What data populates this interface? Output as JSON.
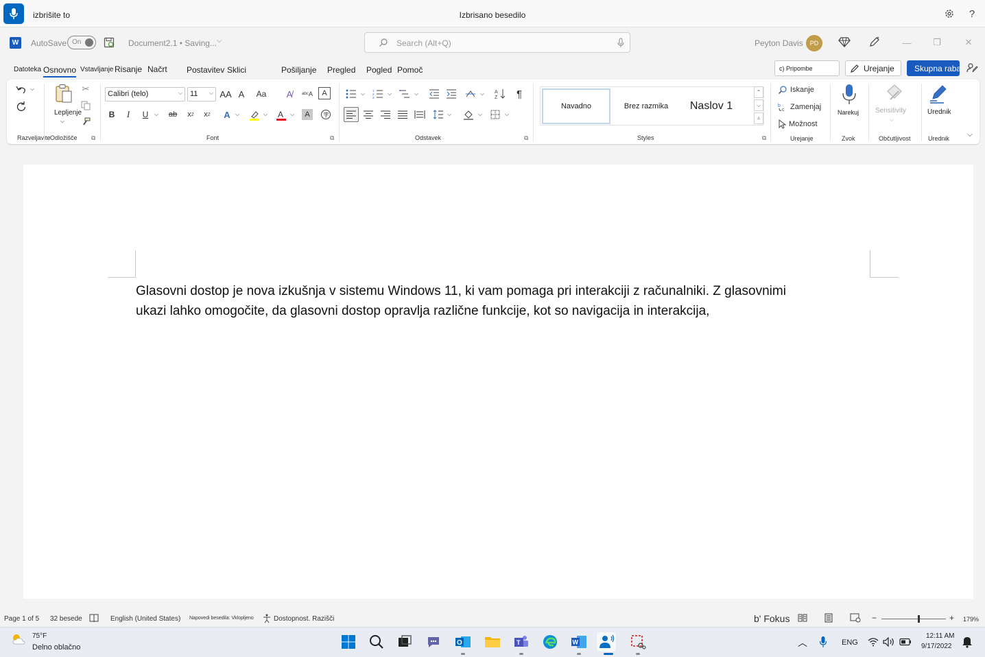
{
  "voice_access": {
    "command_text": "izbrišite to",
    "status_text": "Izbrisano besedilo",
    "settings_icon": "gear-icon",
    "help_label": "?"
  },
  "titlebar": {
    "autosave_label": "AutoSave",
    "autosave_state": "On",
    "document_name": "Document2.1 • Saving...",
    "search_placeholder": "Search (Alt+Q)",
    "user_name": "Peyton Davis",
    "user_initials": "PD"
  },
  "tabs": {
    "items": [
      "Datoteka",
      "Osnovno",
      "Vstavljanje",
      "Risanje",
      "Načrt",
      "Postavitev",
      "Sklici",
      "Pošiljanje",
      "Pregled",
      "Pogled",
      "Pomoč"
    ],
    "active": "Osnovno",
    "comments_label": "c) Pripombe",
    "editing_label": "Urejanje",
    "share_label": "Skupna raba"
  },
  "ribbon": {
    "clipboard": {
      "paste_label": "Lepljenje",
      "undo_group_label": "Razveljavite",
      "group_label": "Odložišče"
    },
    "font": {
      "font_name": "Calibri (telo)",
      "font_size": "11",
      "grow_label": "AA",
      "shrink_label": "A",
      "case_label": "Aa",
      "bold_label": "B",
      "italic_label": "I",
      "underline_label": "U",
      "strike_label": "ab",
      "subscript_label": "x",
      "superscript_label": "x",
      "group_label": "Font",
      "font_color": "#e81123",
      "highlight_color": "#ffff00"
    },
    "paragraph": {
      "group_label": "Odstavek",
      "pilcrow": "¶"
    },
    "styles": {
      "items": [
        "Navadno",
        "Brez razmika",
        "Naslov 1"
      ],
      "selected": "Navadno",
      "group_label": "Styles"
    },
    "editing": {
      "find_label": "Iskanje",
      "replace_label": "Zamenjaj",
      "select_label": "Možnost",
      "group_label": "Urejanje"
    },
    "voice": {
      "dictate_label": "Narekuj",
      "group_label": "Zvok"
    },
    "sensitivity": {
      "button_label": "Sensitivity",
      "group_label": "Občutljivost"
    },
    "editor": {
      "button_label": "Urednik",
      "group_label": "Urednik"
    }
  },
  "document": {
    "line1": "Glasovni dostop je nova izkušnja v sistemu Windows 11, ki vam pomaga pri interakciji z računalniki. Z glasovnimi",
    "line2": "ukazi lahko omogočite, da glasovni dostop opravlja različne funkcije, kot so navigacija in interakcija,"
  },
  "statusbar": {
    "page": "Page 1 of 5",
    "words": "32 besede",
    "language": "English (United States)",
    "predictions": "Napovedi besedila: Vklopljeno",
    "accessibility": "Dostopnost. Razišči",
    "focus": "b' Fokus",
    "zoom_minus": "−",
    "zoom_plus": "+",
    "zoom_level": "179%"
  },
  "taskbar": {
    "weather_temp": "75°F",
    "weather_desc": "Delno oblačno",
    "language": "ENG",
    "time": "12:11 AM",
    "date": "9/17/2022"
  },
  "colors": {
    "accent": "#185abd",
    "voice_accent": "#0067c0"
  }
}
